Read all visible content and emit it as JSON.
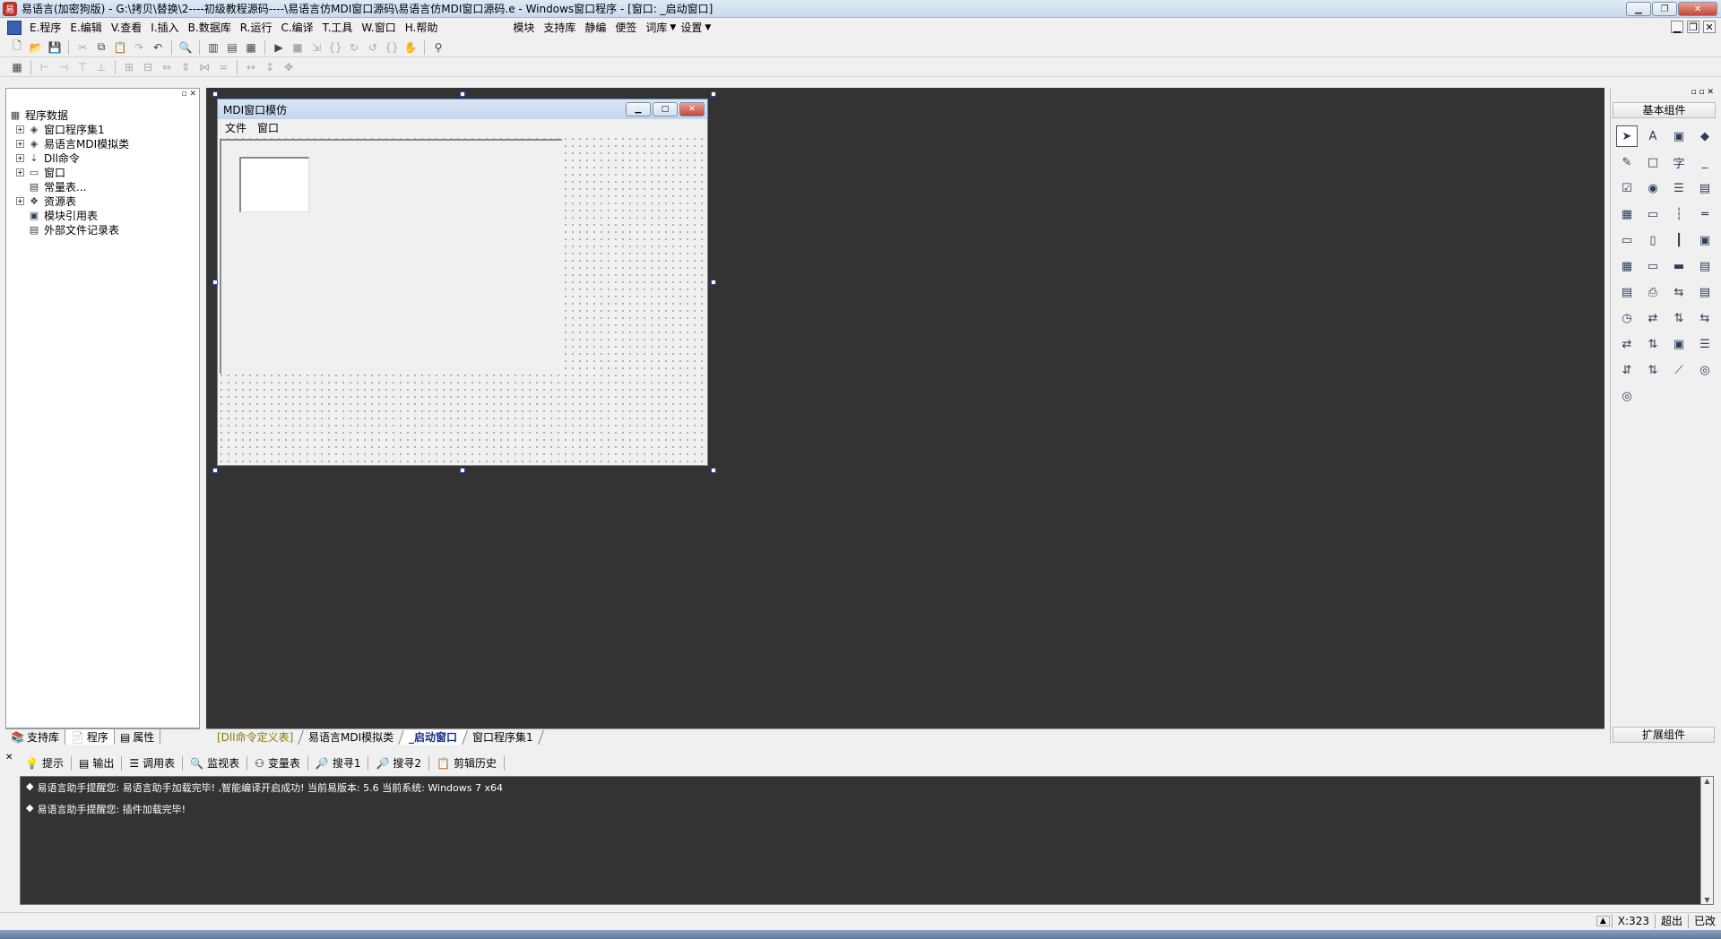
{
  "window": {
    "title": "易语言(加密狗版) - G:\\拷贝\\替换\\2----初级教程源码----\\易语言仿MDI窗口源码\\易语言仿MDI窗口源码.e - Windows窗口程序 - [窗口: _启动窗口]",
    "icon": "app-icon"
  },
  "menu": {
    "items": [
      "E.程序",
      "E.编辑",
      "V.查看",
      "I.插入",
      "B.数据库",
      "R.运行",
      "C.编译",
      "T.工具",
      "W.窗口",
      "H.帮助"
    ],
    "extra": [
      "模块",
      "支持库",
      "静编",
      "便签",
      "词库",
      "设置"
    ]
  },
  "left_panel": {
    "tree": [
      {
        "label": "程序数据",
        "level": 0,
        "expand": "",
        "icon": "database-icon"
      },
      {
        "label": "窗口程序集1",
        "level": 1,
        "expand": "+",
        "icon": "class-icon"
      },
      {
        "label": "易语言MDI模拟类",
        "level": 1,
        "expand": "+",
        "icon": "class-icon"
      },
      {
        "label": "Dll命令",
        "level": 1,
        "expand": "+",
        "icon": "dll-icon"
      },
      {
        "label": "窗口",
        "level": 1,
        "expand": "+",
        "icon": "window-icon"
      },
      {
        "label": "常量表...",
        "level": 1,
        "expand": "",
        "icon": "constant-icon"
      },
      {
        "label": "资源表",
        "level": 1,
        "expand": "+",
        "icon": "resource-icon"
      },
      {
        "label": "模块引用表",
        "level": 1,
        "expand": "",
        "icon": "module-icon"
      },
      {
        "label": "外部文件记录表",
        "level": 1,
        "expand": "",
        "icon": "file-icon"
      }
    ],
    "tabs": [
      "支持库",
      "程序",
      "属性"
    ]
  },
  "designer": {
    "title": "MDI窗口模仿",
    "menu": [
      "文件",
      "窗口"
    ]
  },
  "workspace_tabs": [
    "[Dll命令定义表]",
    "易语言MDI模拟类",
    "_启动窗口",
    "窗口程序集1"
  ],
  "right_panel": {
    "title": "基本组件",
    "bottom": "扩展组件",
    "components": [
      "pointer-icon",
      "label-icon",
      "picture-icon",
      "shape-icon",
      "edit-icon",
      "frame-icon",
      "font-char-icon",
      "line-icon",
      "checkbox-icon",
      "radio-icon",
      "listbox-icon",
      "combobox-icon",
      "grid-icon",
      "ruler-icon",
      "vscroll-icon",
      "hscroll-icon",
      "tab-icon",
      "panel-icon",
      "slider-icon",
      "media-icon",
      "calendar-icon",
      "button-icon",
      "folder-icon",
      "doc-icon",
      "toolbar-icon",
      "printer-icon",
      "splitter-icon",
      "statusbar-icon",
      "timer-icon",
      "transfer-icon",
      "network-icon",
      "network2-icon",
      "client-icon",
      "server-icon",
      "form-icon",
      "list2-icon",
      "data-icon",
      "data2-icon",
      "chart-icon",
      "odbc-icon",
      "odbc2-icon"
    ],
    "component_glyphs": [
      "➤",
      "A",
      "▣",
      "◆",
      "✎",
      "□",
      "字",
      "_",
      "☑",
      "◉",
      "☰",
      "▤",
      "▦",
      "▭",
      "┆",
      "═",
      "▭",
      "▯",
      "┃",
      "▣",
      "▦",
      "▭",
      "▬",
      "▤",
      "▤",
      "⎙",
      "⇆",
      "▤",
      "◷",
      "⇄",
      "⇅",
      "⇆",
      "⇄",
      "⇅",
      "▣",
      "☰",
      "⇵",
      "⇅",
      "⟋",
      "◎",
      "◎"
    ]
  },
  "output_panel": {
    "tabs": [
      "提示",
      "输出",
      "调用表",
      "监视表",
      "变量表",
      "搜寻1",
      "搜寻2",
      "剪辑历史"
    ],
    "lines": [
      "易语言助手提醒您: 易语言助手加载完毕! ,智能编译开启成功! 当前易版本: 5.6 当前系统: Windows 7 x64",
      "易语言助手提醒您: 插件加载完毕!"
    ]
  },
  "status": {
    "coord": "X:323",
    "mode1": "超出",
    "mode2": "已改"
  }
}
